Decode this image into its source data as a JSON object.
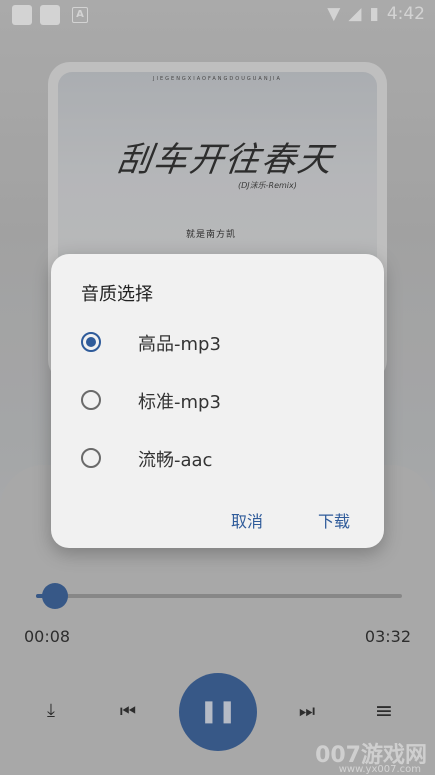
{
  "status_bar": {
    "time": "4:42",
    "icons": [
      "notification-square-icon",
      "notification-square-icon",
      "a-badge-icon",
      "wifi-icon",
      "signal-icon",
      "battery-charging-icon"
    ]
  },
  "cover": {
    "top_line": "JIEGENGXIAOFANGDOUGUANJIA",
    "title": "刮车开往春天",
    "subtitle": "(DJ沫乐-Remix)",
    "artist": "就是南方凯"
  },
  "player": {
    "elapsed": "00:08",
    "duration": "03:32",
    "progress": 0.04
  },
  "dialog": {
    "title": "音质选择",
    "options": [
      {
        "label": "高品-mp3",
        "selected": true
      },
      {
        "label": "标准-mp3",
        "selected": false
      },
      {
        "label": "流畅-aac",
        "selected": false
      }
    ],
    "cancel": "取消",
    "confirm": "下载"
  },
  "controls": {
    "download": "⤓",
    "prev": "⏮",
    "play_pause": "❚❚",
    "next": "⏭",
    "playlist": "≡"
  },
  "watermark": {
    "text": "007游戏网",
    "url": "www.yx007.com"
  },
  "colors": {
    "accent": "#2f5b9a"
  }
}
